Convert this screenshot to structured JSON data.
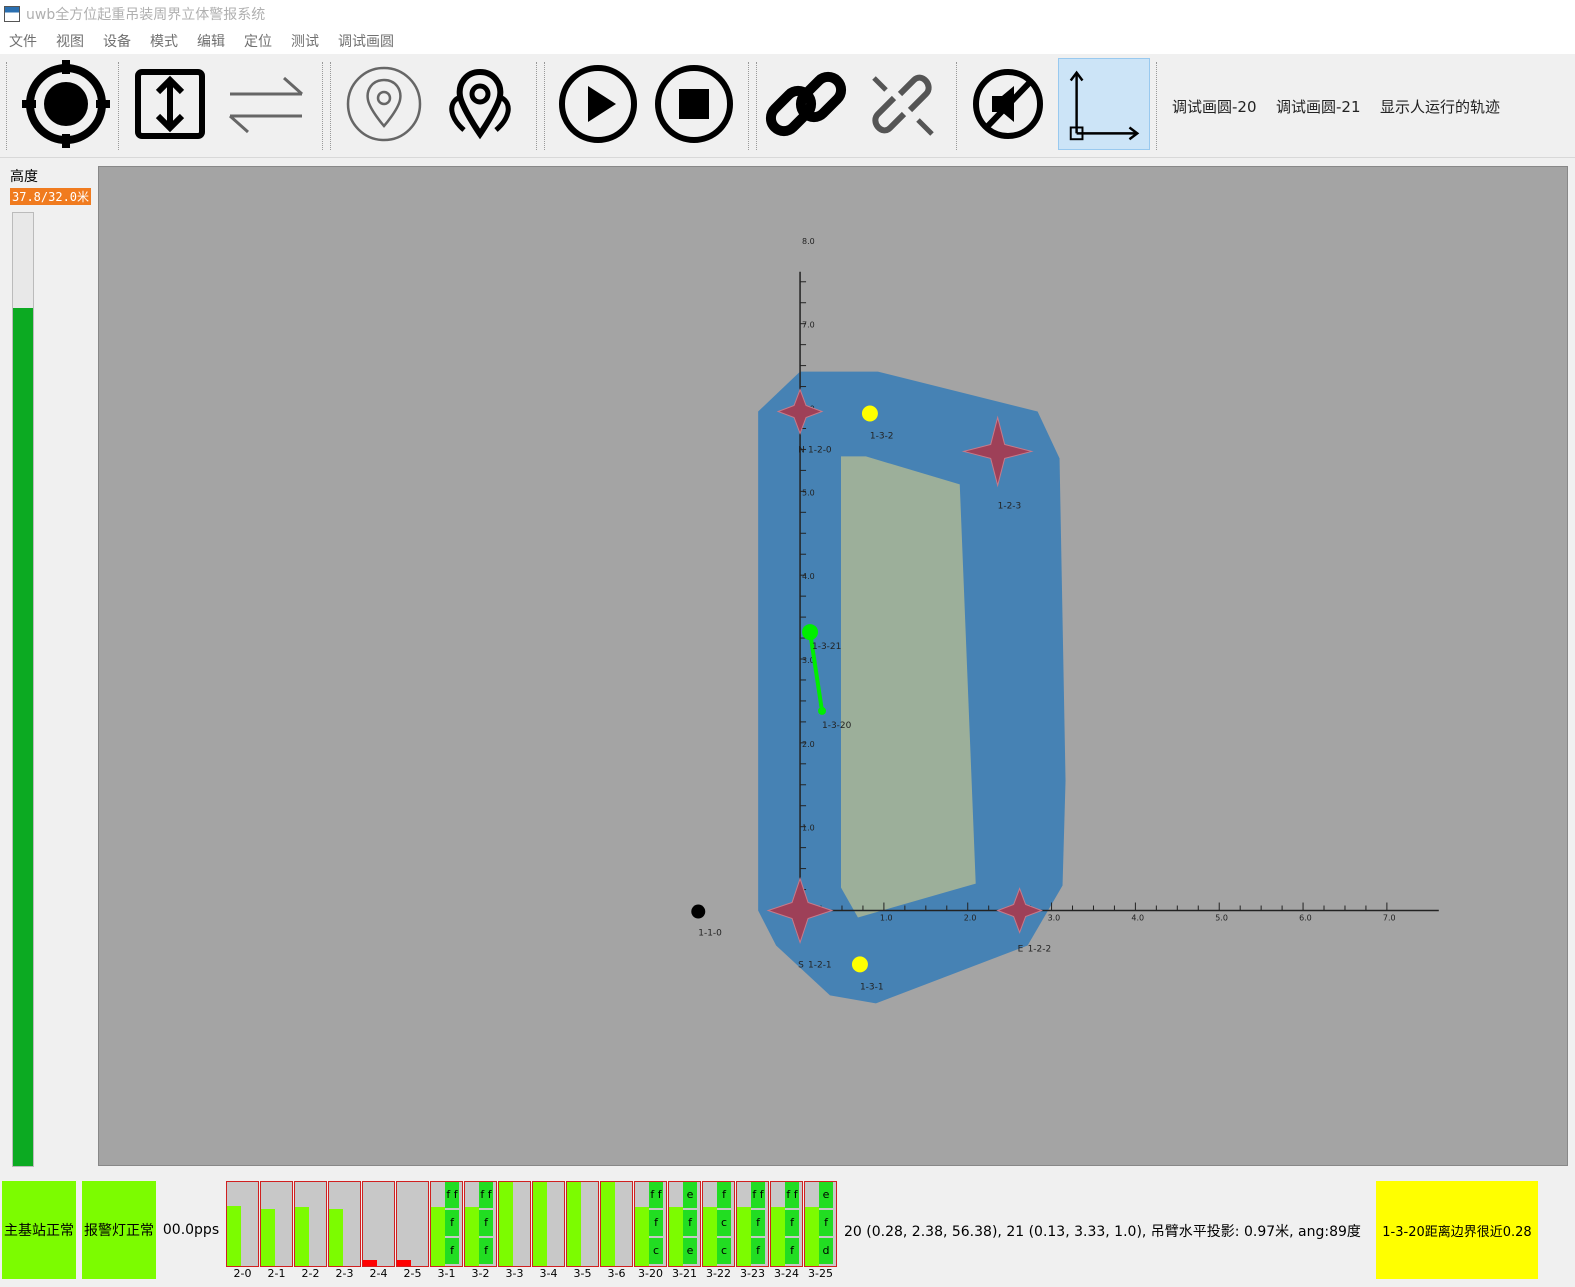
{
  "window": {
    "title": "uwb全方位起重吊装周界立体警报系统"
  },
  "menu": [
    "文件",
    "视图",
    "设备",
    "模式",
    "编辑",
    "定位",
    "测试",
    "调试画圆"
  ],
  "toolbar": {
    "icons": [
      "target-icon",
      "vertical-arrows-icon",
      "swap-arrows-icon",
      "location-pin-icon",
      "multi-location-icon",
      "play-icon",
      "stop-icon",
      "link-icon",
      "unlink-icon",
      "mute-icon",
      "axes-icon"
    ],
    "text_buttons": [
      "调试画圆-20",
      "调试画圆-21",
      "显示人运行的轨迹"
    ]
  },
  "height_panel": {
    "label": "高度",
    "value": "37.8/32.0米",
    "level_fraction": 0.9
  },
  "scene": {
    "x_ticks": [
      "1.0",
      "2.0",
      "3.0",
      "4.0",
      "5.0",
      "6.0",
      "7.0"
    ],
    "y_ticks": [
      "1.0",
      "2.0",
      "3.0",
      "4.0",
      "5.0",
      "6.0",
      "7.0",
      "8.0"
    ],
    "anchors": [
      {
        "label": "1-2-0",
        "prefix": "N"
      },
      {
        "label": "1-2-1",
        "prefix": "S"
      },
      {
        "label": "1-2-2",
        "prefix": "E"
      },
      {
        "label": "1-2-3",
        "prefix": ""
      }
    ],
    "tags": [
      {
        "label": "1-3-1",
        "color": "#ffff00"
      },
      {
        "label": "1-3-2",
        "color": "#ffff00"
      },
      {
        "label": "1-3-21",
        "color": "#00ee00"
      },
      {
        "label": "1-3-20",
        "color": "#00ee00"
      },
      {
        "label": "1-1-0",
        "color": "#000000"
      }
    ],
    "colors": {
      "background": "#a4a4a4",
      "boundary": "#4682b4",
      "inner_zone": "#9caf9a",
      "anchor": "#9e4058"
    }
  },
  "status": {
    "main_station": "主基站正常",
    "alarm_light": "报警灯正常",
    "rate": "00.0pps",
    "coords": "20 (0.28, 2.38, 56.38), 21 (0.13, 3.33, 1.0), 吊臂水平投影: 0.97米, ang:89度",
    "warning": "1-3-20距离边界很近0.28"
  },
  "sensors": [
    {
      "label": "2-0",
      "level": 0.72
    },
    {
      "label": "2-1",
      "level": 0.68
    },
    {
      "label": "2-2",
      "level": 0.7
    },
    {
      "label": "2-3",
      "level": 0.68
    },
    {
      "label": "2-4",
      "level": 0.07,
      "red": true
    },
    {
      "label": "2-5",
      "level": 0.07,
      "red": true
    },
    {
      "label": "3-1",
      "cells": [
        "f f",
        "f 0",
        "f 0"
      ]
    },
    {
      "label": "3-2",
      "cells": [
        "f f",
        "f 0",
        "f 0"
      ]
    },
    {
      "label": "3-3",
      "level": 1.0
    },
    {
      "label": "3-4",
      "level": 1.0
    },
    {
      "label": "3-5",
      "level": 1.0
    },
    {
      "label": "3-6",
      "level": 1.0
    },
    {
      "label": "3-20",
      "cells": [
        "f f",
        "f 0",
        "c 0"
      ]
    },
    {
      "label": "3-21",
      "cells": [
        "e f",
        "f 0",
        "e 0"
      ]
    },
    {
      "label": "3-22",
      "cells": [
        "f e",
        "c 0",
        "c 0"
      ]
    },
    {
      "label": "3-23",
      "cells": [
        "f f",
        "f 0",
        "f 0"
      ]
    },
    {
      "label": "3-24",
      "cells": [
        "f f",
        "f 0",
        "f 0"
      ]
    },
    {
      "label": "3-25",
      "cells": [
        "e e",
        "f 0",
        "d 0"
      ]
    }
  ]
}
